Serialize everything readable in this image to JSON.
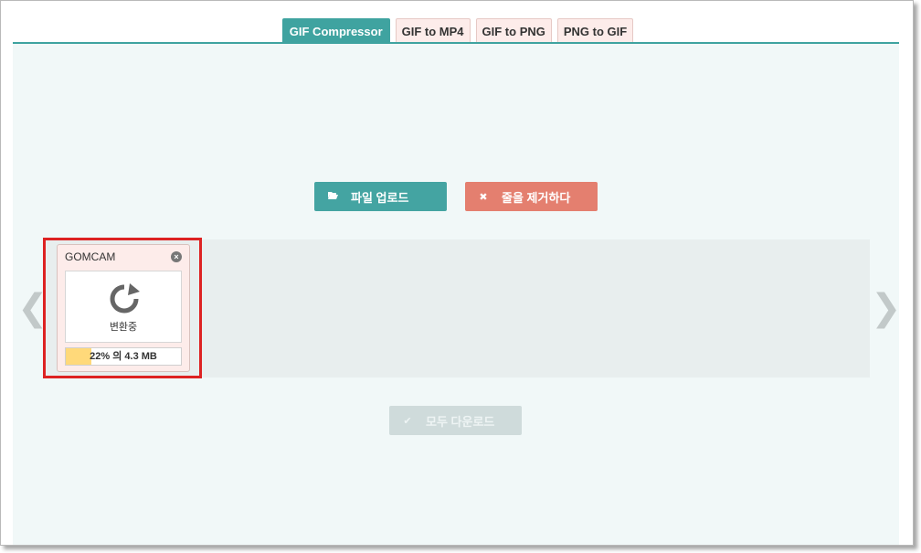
{
  "tabs": [
    {
      "label": "GIF Compressor",
      "active": true
    },
    {
      "label": "GIF to MP4",
      "active": false
    },
    {
      "label": "GIF to PNG",
      "active": false
    },
    {
      "label": "PNG to GIF",
      "active": false
    }
  ],
  "actions": {
    "upload_label": "파일 업로드",
    "upload_icon": "folder-open-icon",
    "clear_label": "줄을 제거하다",
    "clear_icon": "x-icon",
    "download_all_label": "모두 다운로드",
    "download_all_icon": "check-icon"
  },
  "queue": {
    "prev_glyph": "❮",
    "next_glyph": "❯",
    "file": {
      "name": "GOMCAM",
      "status": "변환중",
      "progress_text": "22% 의 4.3 MB",
      "progress_fraction": 0.22
    }
  },
  "colors": {
    "accent": "#3fa3a0",
    "clear_button": "#e47f6f",
    "highlight": "#dd2222",
    "progress_fill": "#ffd97a"
  }
}
